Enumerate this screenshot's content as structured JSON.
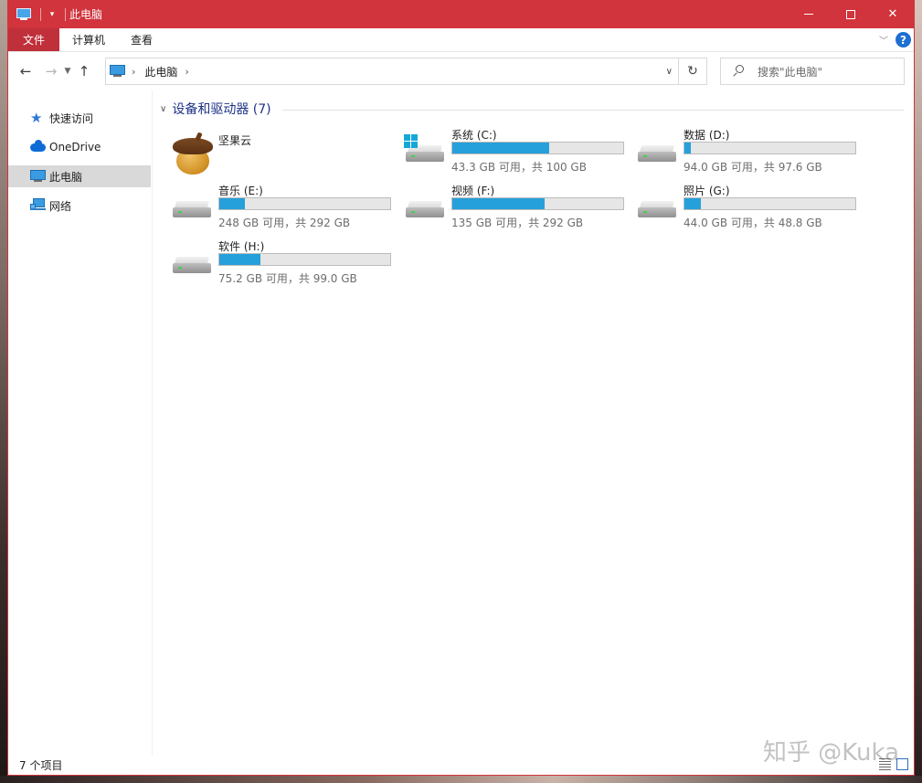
{
  "window": {
    "title": "此电脑",
    "qat_arrow": "▾"
  },
  "ribbon": {
    "tabs": [
      "文件",
      "计算机",
      "查看"
    ]
  },
  "address": {
    "path": "此电脑",
    "separator": "›",
    "search_placeholder": "搜索\"此电脑\""
  },
  "nav": [
    {
      "label": "快速访问",
      "icon": "star-icon"
    },
    {
      "label": "OneDrive",
      "icon": "cloud-icon"
    },
    {
      "label": "此电脑",
      "icon": "computer-icon",
      "selected": true
    },
    {
      "label": "网络",
      "icon": "network-icon"
    }
  ],
  "group": {
    "title": "设备和驱动器 (7)"
  },
  "items": [
    {
      "name": "坚果云",
      "type": "app",
      "icon": "acorn-icon"
    },
    {
      "name": "系统 (C:)",
      "free": "43.3 GB 可用，共 100 GB",
      "used_fraction": 0.567,
      "icon": "windows-drive-icon"
    },
    {
      "name": "数据 (D:)",
      "free": "94.0 GB 可用，共 97.6 GB",
      "used_fraction": 0.037,
      "icon": "drive-icon"
    },
    {
      "name": "音乐 (E:)",
      "free": "248 GB 可用，共 292 GB",
      "used_fraction": 0.151,
      "icon": "drive-icon"
    },
    {
      "name": "视频 (F:)",
      "free": "135 GB 可用，共 292 GB",
      "used_fraction": 0.538,
      "icon": "drive-icon"
    },
    {
      "name": "照片 (G:)",
      "free": "44.0 GB 可用，共 48.8 GB",
      "used_fraction": 0.098,
      "icon": "drive-icon"
    },
    {
      "name": "软件 (H:)",
      "free": "75.2 GB 可用，共 99.0 GB",
      "used_fraction": 0.24,
      "icon": "drive-icon"
    }
  ],
  "status": {
    "count": "7 个项目"
  },
  "watermark": "知乎 @Kuka",
  "colors": {
    "titlebar": "#d1343c",
    "bar_fill": "#26a0da",
    "group_header": "#1e3287"
  }
}
